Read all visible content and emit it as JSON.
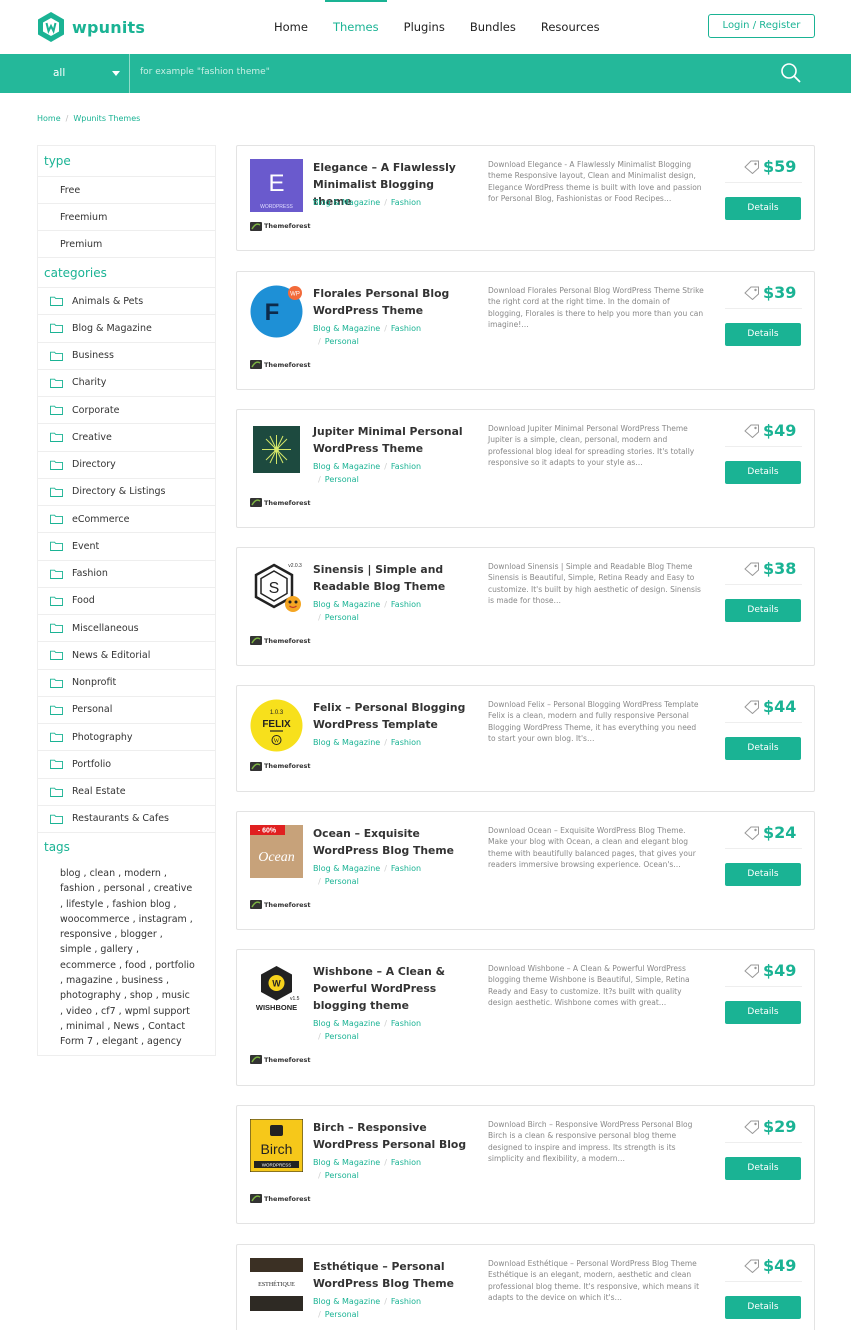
{
  "brand": {
    "name": "wpunits",
    "color": "#1ab394"
  },
  "nav": [
    "Home",
    "Themes",
    "Plugins",
    "Bundles",
    "Resources"
  ],
  "login_label": "Login / Register",
  "search": {
    "select_value": "all",
    "placeholder": "for example \"fashion theme\"",
    "icon": "search-icon"
  },
  "breadcrumb": [
    "Home",
    "Wpunits Themes"
  ],
  "sidebar": {
    "type_title": "type",
    "types": [
      "Free",
      "Freemium",
      "Premium"
    ],
    "categories_title": "categories",
    "categories": [
      "Animals & Pets",
      "Blog & Magazine",
      "Business",
      "Charity",
      "Corporate",
      "Creative",
      "Directory",
      "Directory & Listings",
      "eCommerce",
      "Event",
      "Fashion",
      "Food",
      "Miscellaneous",
      "News & Editorial",
      "Nonprofit",
      "Personal",
      "Photography",
      "Portfolio",
      "Real Estate",
      "Restaurants & Cafes"
    ],
    "tags_title": "tags",
    "tags": "blog , clean , modern , fashion , personal , creative , lifestyle , fashion blog , woocommerce , instagram , responsive , blogger , simple , gallery , ecommerce , food , portfolio , magazine , business , photography , shop , music , video , cf7 , wpml support , minimal , News , Contact Form 7 , elegant , agency"
  },
  "products": [
    {
      "title": "Elegance – A Flawlessly Minimalist Blogging theme",
      "cats": [
        "Blog & Magazine",
        "Fashion"
      ],
      "desc": "Download Elegance - A Flawlessly Minimalist Blogging theme Responsive layout, Clean and Minimalist design, Elegance WordPress theme is built with love and passion for Personal Blog, Fashionistas or Food Recipes…",
      "price": "$59",
      "details": "Details",
      "source": "Themeforest",
      "thumb": {
        "letter": "E",
        "caption": "WORDPRESS"
      }
    },
    {
      "title": "Florales Personal Blog WordPress Theme",
      "cats": [
        "Blog & Magazine",
        "Fashion",
        "Personal"
      ],
      "desc": "Download Florales Personal Blog WordPress Theme Strike the right cord at the right time. In the domain of blogging, Florales is there to help you more than you can imagine!…",
      "price": "$39",
      "details": "Details",
      "source": "Themeforest",
      "thumb": {
        "letter": "F",
        "badge": "WP"
      }
    },
    {
      "title": "Jupiter Minimal Personal WordPress Theme",
      "cats": [
        "Blog & Magazine",
        "Fashion",
        "Personal"
      ],
      "desc": "Download Jupiter Minimal Personal WordPress Theme Jupiter is a simple, clean, personal, modern and professional blog ideal for spreading stories. It's totally responsive so it adapts to your style as…",
      "price": "$49",
      "details": "Details",
      "source": "Themeforest",
      "thumb": {}
    },
    {
      "title": "Sinensis | Simple and Readable Blog Theme",
      "cats": [
        "Blog & Magazine",
        "Fashion",
        "Personal"
      ],
      "desc": "Download Sinensis | Simple and Readable Blog Theme Sinensis is Beautiful, Simple, Retina Ready and Easy to customize. It's built by high aesthetic of design. Sinensis is made for those…",
      "price": "$38",
      "details": "Details",
      "source": "Themeforest",
      "thumb": {
        "letter": "S",
        "version": "v2.0.3"
      }
    },
    {
      "title": "Felix – Personal Blogging WordPress Template",
      "cats": [
        "Blog & Magazine",
        "Fashion"
      ],
      "desc": "Download Felix – Personal Blogging WordPress Template Felix is a clean, modern and fully responsive Personal Blogging WordPress Theme, it has everything you need to start your own blog. It's…",
      "price": "$44",
      "details": "Details",
      "source": "Themeforest",
      "thumb": {
        "word": "FELIX",
        "version": "1.0.3"
      }
    },
    {
      "title": "Ocean – Exquisite WordPress Blog Theme",
      "cats": [
        "Blog & Magazine",
        "Fashion",
        "Personal"
      ],
      "desc": "Download Ocean – Exquisite WordPress Blog Theme. Make your blog with Ocean, a clean and elegant blog theme with beautifully balanced pages, that gives your readers immersive browsing experience. Ocean's…",
      "price": "$24",
      "details": "Details",
      "source": "Themeforest",
      "thumb": {
        "word": "Ocean",
        "badge": "- 60%"
      }
    },
    {
      "title": "Wishbone – A Clean & Powerful WordPress blogging theme",
      "cats": [
        "Blog & Magazine",
        "Fashion",
        "Personal"
      ],
      "desc": "Download Wishbone – A Clean & Powerful WordPress blogging theme Wishbone is Beautiful, Simple, Retina Ready and Easy to customize. It?s built with quality design aesthetic. Wishbone comes with great…",
      "price": "$49",
      "details": "Details",
      "source": "Themeforest",
      "thumb": {
        "letter": "W",
        "word": "WISHBONE",
        "version": "v1.5"
      }
    },
    {
      "title": "Birch – Responsive WordPress Personal Blog",
      "cats": [
        "Blog & Magazine",
        "Fashion",
        "Personal"
      ],
      "desc": "Download Birch – Responsive WordPress Personal Blog Birch is a clean & responsive personal blog theme designed to inspire and impress. Its strength is its simplicity and flexibility, a modern…",
      "price": "$29",
      "details": "Details",
      "source": "Themeforest",
      "thumb": {
        "word": "Birch",
        "caption": "WORDPRESS"
      }
    },
    {
      "title": "Esthétique – Personal WordPress Blog Theme",
      "cats": [
        "Blog & Magazine",
        "Fashion",
        "Personal"
      ],
      "desc": "Download Esthétique – Personal WordPress Blog Theme Esthétique is an elegant, modern, aesthetic and clean professional blog theme. It's responsive, which means it adapts to the device on which it's…",
      "price": "$49",
      "details": "Details",
      "source": "Themeforest",
      "thumb": {
        "word": "ESTHÉTIQUE"
      }
    }
  ]
}
